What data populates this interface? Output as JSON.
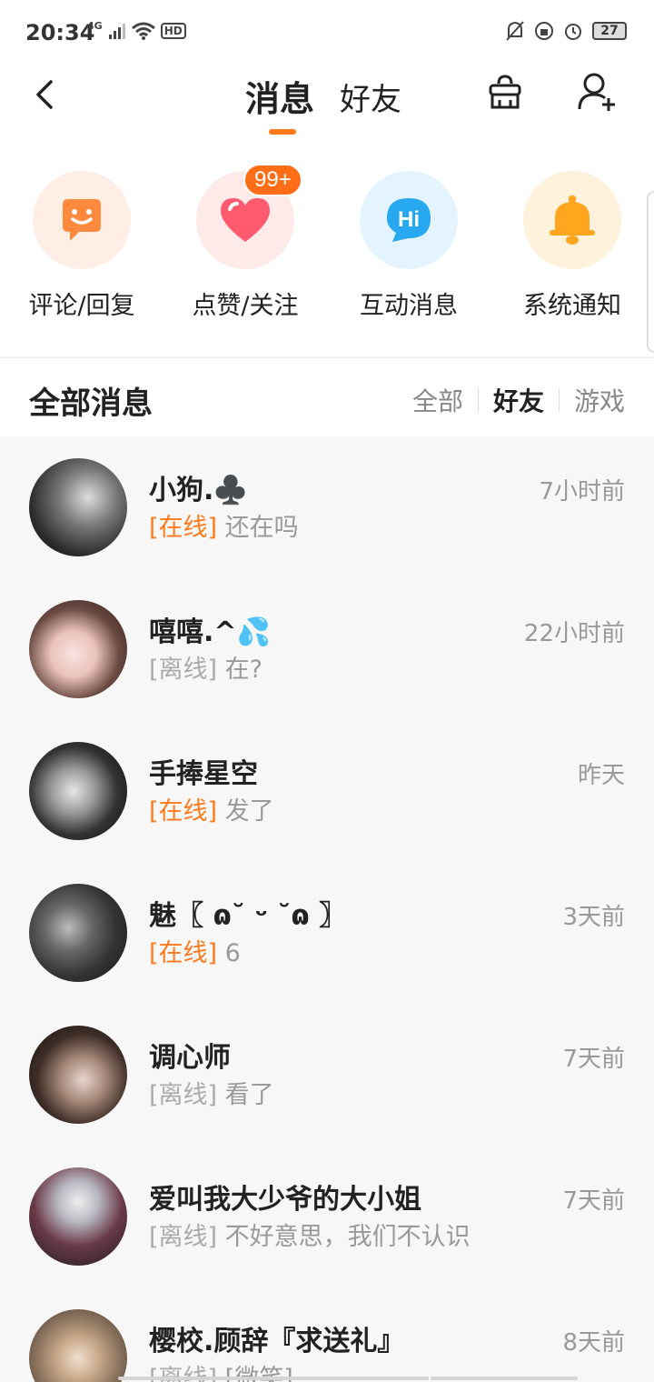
{
  "status_bar": {
    "time": "20:34",
    "network": "4G",
    "hd": "HD",
    "battery": "27"
  },
  "header": {
    "tab_messages": "消息",
    "tab_friends": "好友",
    "accent_color": "#ff7a1a"
  },
  "quick_entries": [
    {
      "label": "评论/回复",
      "icon": "smile-chat-icon",
      "bg": "#ffeee6",
      "fg": "#ff8a3d"
    },
    {
      "label": "点赞/关注",
      "icon": "heart-icon",
      "bg": "#ffeaea",
      "fg": "#ff5a6e",
      "badge": "99+"
    },
    {
      "label": "互动消息",
      "icon": "hi-chat-icon",
      "bg": "#e4f4ff",
      "fg": "#27a8f0",
      "text": "Hi"
    },
    {
      "label": "系统通知",
      "icon": "bell-icon",
      "bg": "#fff2dd",
      "fg": "#ffa51e"
    }
  ],
  "section": {
    "title": "全部消息",
    "filters": [
      "全部",
      "好友",
      "游戏"
    ],
    "active_filter": "好友"
  },
  "conversations": [
    {
      "name": "小狗.♣️",
      "status": "[在线]",
      "online": true,
      "message": "还在吗",
      "time": "7小时前"
    },
    {
      "name": "嘻嘻.^💦",
      "status": "[离线]",
      "online": false,
      "message": "在?",
      "time": "22小时前"
    },
    {
      "name": "手捧星空",
      "status": "[在线]",
      "online": true,
      "message": "发了",
      "time": "昨天"
    },
    {
      "name": "魅〖 ɷ˘ ᵕ ˘ɷ 〗",
      "status": "[在线]",
      "online": true,
      "message": "6",
      "time": "3天前"
    },
    {
      "name": "调心师",
      "status": "[离线]",
      "online": false,
      "message": "看了",
      "time": "7天前"
    },
    {
      "name": "爱叫我大少爷的大小姐",
      "status": "[离线]",
      "online": false,
      "message": "不好意思，我们不认识",
      "time": "7天前"
    },
    {
      "name": "樱校.顾辞『求送礼』",
      "status": "[离线]",
      "online": false,
      "message": "[微笑]",
      "time": "8天前"
    }
  ]
}
